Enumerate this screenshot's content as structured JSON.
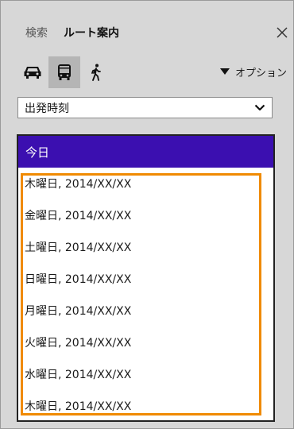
{
  "tabs": {
    "search": "検索",
    "route": "ルート案内"
  },
  "icons": {
    "close": "close-icon",
    "car": "car-icon",
    "bus": "bus-icon",
    "walk": "walk-icon",
    "options": "triangle-down-icon",
    "dropdown": "chevron-down-icon"
  },
  "options_label": "オプション",
  "time_select": {
    "value": "出発時刻"
  },
  "date_list": {
    "selected": "今日",
    "items": [
      "木曜日, 2014/XX/XX",
      "金曜日, 2014/XX/XX",
      "土曜日, 2014/XX/XX",
      "日曜日, 2014/XX/XX",
      "月曜日, 2014/XX/XX",
      "火曜日, 2014/XX/XX",
      "水曜日, 2014/XX/XX",
      "木曜日, 2014/XX/XX"
    ]
  },
  "colors": {
    "selected_bg": "#3b0fb0",
    "highlight": "#f08a00",
    "active_mode_bg": "#b5b5b5"
  }
}
